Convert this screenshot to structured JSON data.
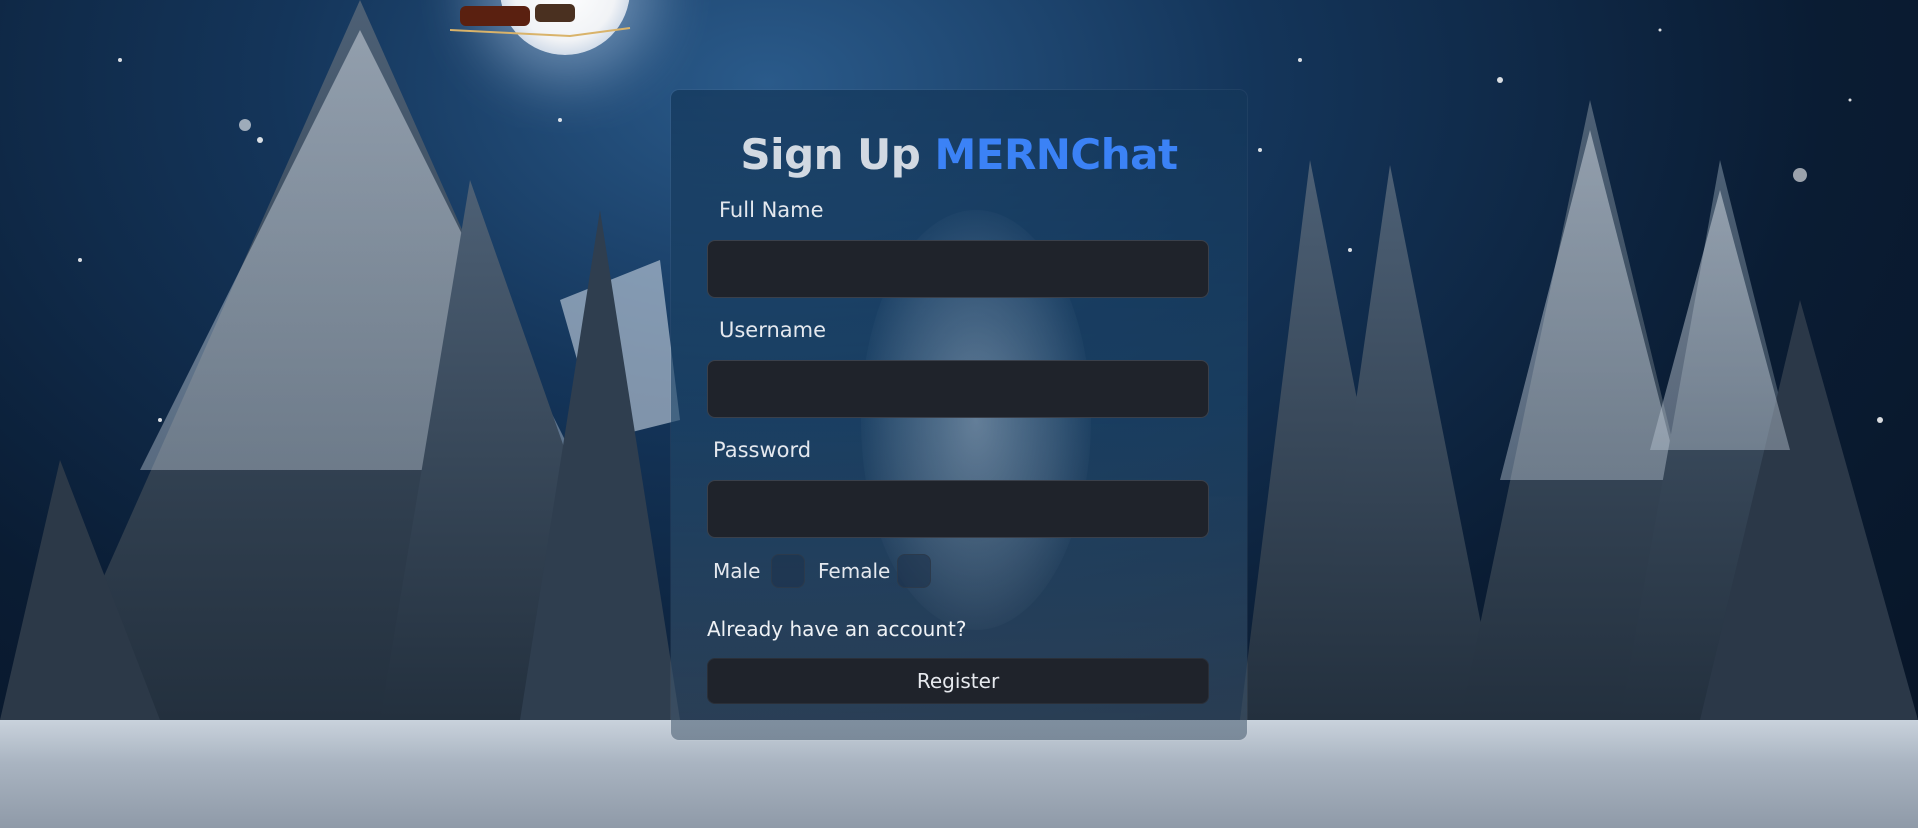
{
  "form": {
    "title_prefix": "Sign Up",
    "title_brand": "MERNChat",
    "full_name_label": "Full Name",
    "username_label": "Username",
    "password_label": "Password",
    "full_name_value": "",
    "username_value": "",
    "password_value": "",
    "gender_male_label": "Male",
    "gender_female_label": "Female",
    "login_link": "Already have an account?",
    "register_button": "Register"
  },
  "colors": {
    "brand": "#3b82f6",
    "input_bg": "#1f232b",
    "button_bg": "#1f232b"
  }
}
